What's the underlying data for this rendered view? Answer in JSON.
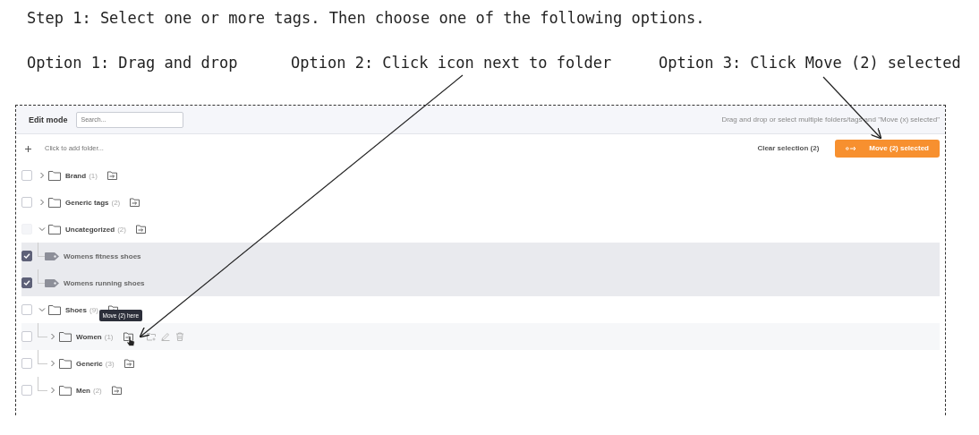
{
  "instructions": {
    "step": "Step 1: Select one or more tags. Then choose one of the following options.",
    "options": [
      "Option 1: Drag and drop",
      "Option 2: Click icon next to folder",
      "Option 3: Click Move (2) selected"
    ]
  },
  "panel": {
    "mode_label": "Edit mode",
    "search": {
      "placeholder": "Search..."
    },
    "hint": "Drag and drop or select multiple folders/tags and \"Move (x) selected\"",
    "add_folder": {
      "placeholder": "Click to add folder..."
    },
    "clear_selection": "Clear selection (2)",
    "move_button": "Move (2) selected",
    "tree": [
      {
        "kind": "folder",
        "name": "Brand",
        "count": "(1)",
        "checked": false,
        "disabled": false,
        "expanded": false,
        "hovered": false
      },
      {
        "kind": "folder",
        "name": "Generic tags",
        "count": "(2)",
        "checked": false,
        "disabled": false,
        "expanded": false,
        "hovered": false
      },
      {
        "kind": "folder",
        "name": "Uncategorized",
        "count": "(2)",
        "checked": false,
        "disabled": true,
        "expanded": true,
        "hovered": false,
        "children": [
          {
            "kind": "tag",
            "name": "Womens fitness shoes",
            "checked": true,
            "disabled": false,
            "hovered": false
          },
          {
            "kind": "tag",
            "name": "Womens running shoes",
            "checked": true,
            "disabled": false,
            "hovered": false
          }
        ]
      },
      {
        "kind": "folder",
        "name": "Shoes",
        "count": "(9)",
        "checked": false,
        "disabled": false,
        "expanded": true,
        "hovered": false,
        "children": [
          {
            "kind": "folder",
            "name": "Women",
            "count": "(1)",
            "checked": false,
            "disabled": false,
            "expanded": false,
            "hovered": true,
            "tooltip": "Move (2) here"
          },
          {
            "kind": "folder",
            "name": "Generic",
            "count": "(3)",
            "checked": false,
            "disabled": false,
            "expanded": false,
            "hovered": false
          },
          {
            "kind": "folder",
            "name": "Men",
            "count": "(2)",
            "checked": false,
            "disabled": false,
            "expanded": false,
            "hovered": false
          }
        ]
      }
    ]
  }
}
